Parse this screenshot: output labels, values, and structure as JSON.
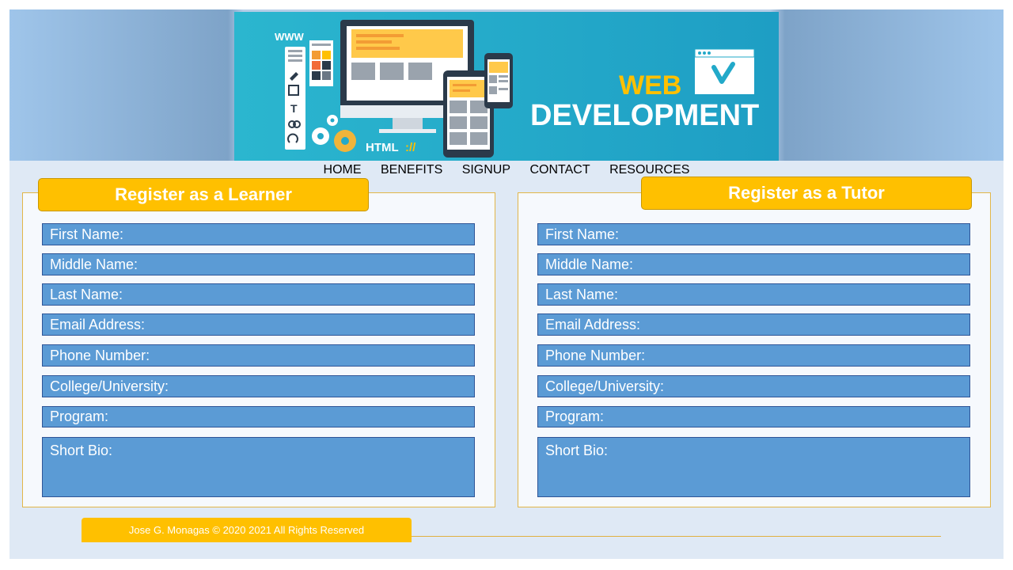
{
  "banner": {
    "www_label": "WWW",
    "html_label": "HTML",
    "html_suffix": "://",
    "title_line1": "WEB",
    "title_line2": "DEVELOPMENT"
  },
  "nav": {
    "items": [
      "HOME",
      "BENEFITS",
      "SIGNUP",
      "CONTACT",
      "RESOURCES"
    ]
  },
  "learner_form": {
    "title": "Register as a Learner",
    "fields": [
      "First Name:",
      "Middle Name:",
      "Last Name:",
      "Email Address:",
      "Phone Number:",
      "College/University:",
      "Program:",
      "Short Bio:"
    ]
  },
  "tutor_form": {
    "title": "Register as a Tutor",
    "fields": [
      "First Name:",
      "Middle Name:",
      "Last Name:",
      "Email Address:",
      "Phone Number:",
      "College/University:",
      "Program:",
      "Short Bio:"
    ]
  },
  "footer": {
    "copyright": "Jose G. Monagas © 2020 2021 All Rights Reserved"
  },
  "colors": {
    "accent": "#ffc000",
    "field_fill": "#5b9bd5",
    "field_border": "#2f5597",
    "banner": "#22a9c9"
  }
}
